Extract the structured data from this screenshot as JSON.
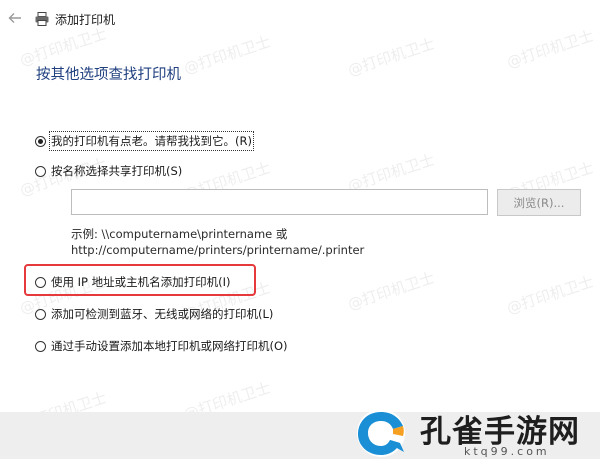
{
  "window": {
    "title": "添加打印机"
  },
  "heading": "按其他选项查找打印机",
  "options": [
    {
      "label": "我的打印机有点老。请帮我找到它。(R)",
      "checked": true
    },
    {
      "label": "按名称选择共享打印机(S)",
      "checked": false
    },
    {
      "label": "使用 IP 地址或主机名添加打印机(I)",
      "checked": false
    },
    {
      "label": "添加可检测到蓝牙、无线或网络的打印机(L)",
      "checked": false
    },
    {
      "label": "通过手动设置添加本地打印机或网络打印机(O)",
      "checked": false
    }
  ],
  "share": {
    "value": "",
    "browse_label": "浏览(R)...",
    "example_line1": "示例: \\\\computername\\printername 或",
    "example_line2": "http://computername/printers/printername/.printer"
  },
  "watermark": "@打印机卫士",
  "logo": {
    "name": "孔雀手游网",
    "domain": "ktq99.com"
  },
  "colors": {
    "heading": "#1f3f7f",
    "highlight": "#e5393b",
    "logo_blue": "#1a8fd6",
    "logo_orange": "#f5a020"
  }
}
